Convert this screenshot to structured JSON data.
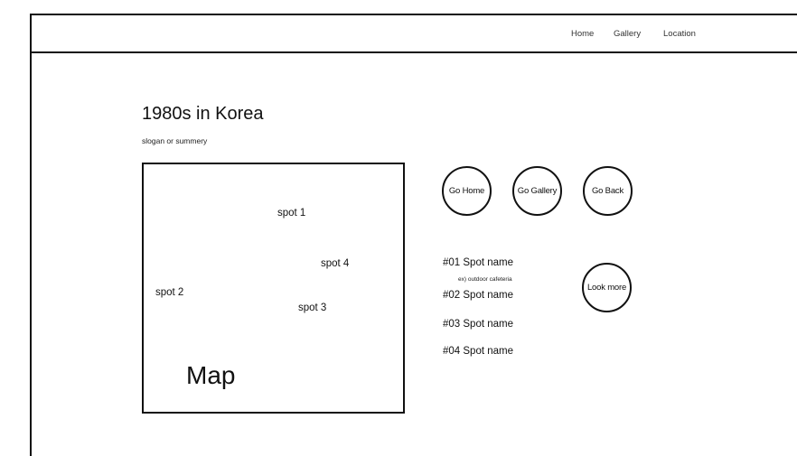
{
  "nav": {
    "items": [
      {
        "label": "Home"
      },
      {
        "label": "Gallery"
      },
      {
        "label": "Location"
      }
    ]
  },
  "hero": {
    "title": "1980s in Korea",
    "slogan": "slogan or summery"
  },
  "map": {
    "label": "Map",
    "spots": [
      {
        "label": "spot 1"
      },
      {
        "label": "spot 2"
      },
      {
        "label": "spot 3"
      },
      {
        "label": "spot 4"
      }
    ]
  },
  "buttons": {
    "go_home": "Go Home",
    "go_gallery": "Go Gallery",
    "go_back": "Go Back",
    "look_more": "Look more"
  },
  "spot_list": [
    {
      "label": "#01 Spot name",
      "detail": "ex) outdoor cafeteria"
    },
    {
      "label": "#02 Spot name"
    },
    {
      "label": "#03 Spot name"
    },
    {
      "label": "#04 Spot name"
    }
  ]
}
